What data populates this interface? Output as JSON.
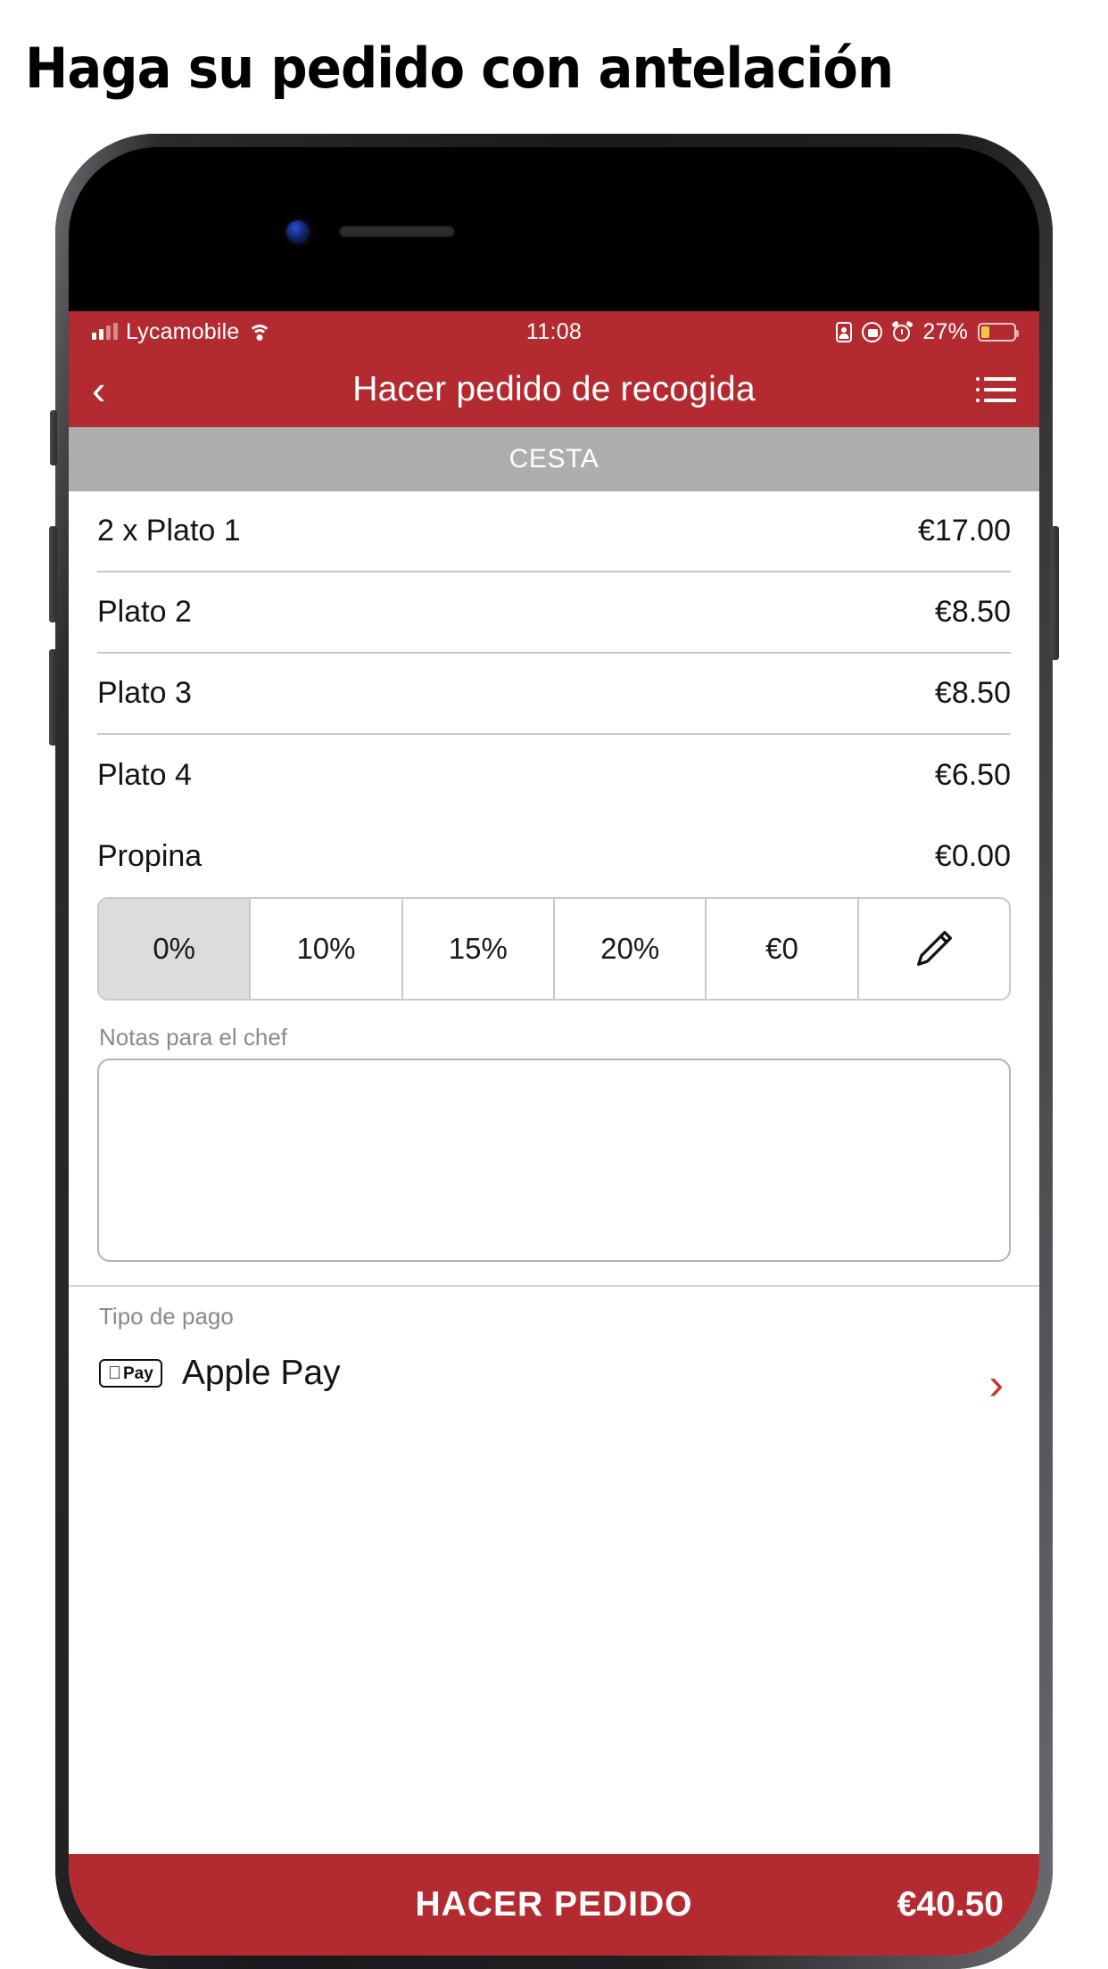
{
  "headline": "Haga su pedido con antelación",
  "status_bar": {
    "carrier": "Lycamobile",
    "time": "11:08",
    "battery_percent": "27%",
    "icons": [
      "signal-bars-icon",
      "wifi-icon",
      "id-card-icon",
      "rotation-lock-icon",
      "alarm-clock-icon",
      "battery-icon"
    ]
  },
  "nav": {
    "back_icon": "chevron-left-icon",
    "title": "Hacer pedido de recogida",
    "menu_icon": "list-menu-icon"
  },
  "section_header": "CESTA",
  "cart": {
    "items": [
      {
        "name": "2 x Plato 1",
        "price": "€17.00"
      },
      {
        "name": "Plato 2",
        "price": "€8.50"
      },
      {
        "name": "Plato 3",
        "price": "€8.50"
      },
      {
        "name": "Plato 4",
        "price": "€6.50"
      }
    ],
    "tip": {
      "label": "Propina",
      "amount": "€0.00"
    }
  },
  "tip_options": [
    {
      "label": "0%",
      "selected": true
    },
    {
      "label": "10%",
      "selected": false
    },
    {
      "label": "15%",
      "selected": false
    },
    {
      "label": "20%",
      "selected": false
    },
    {
      "label": "€0",
      "selected": false
    },
    {
      "label": "pencil-icon",
      "selected": false
    }
  ],
  "notes": {
    "label": "Notas para el chef",
    "value": "",
    "placeholder": ""
  },
  "payment": {
    "label": "Tipo de pago",
    "badge_apple": "",
    "badge_pay": "Pay",
    "method": "Apple Pay",
    "chevron_icon": "chevron-right-icon"
  },
  "cta": {
    "label": "HACER PEDIDO",
    "total": "€40.50"
  },
  "colors": {
    "brand_red": "#B32B31",
    "section_gray": "#AEAEAE",
    "accent_chevron": "#C0392F",
    "battery_yellow": "#F5C542"
  }
}
